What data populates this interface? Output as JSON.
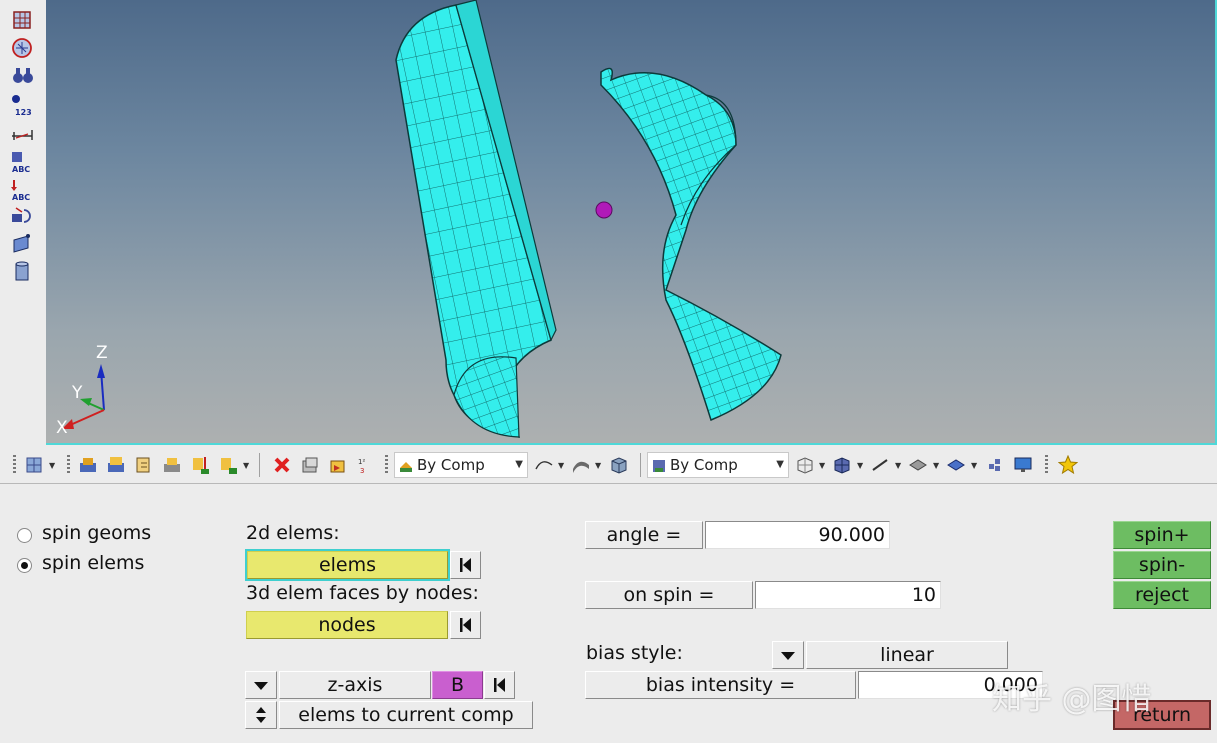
{
  "viewport": {
    "axis_labels": {
      "z": "Z",
      "y": "Y",
      "x": "X"
    },
    "colors": {
      "mesh": "#33f0ee",
      "mesh_edge": "#0c5a5a",
      "temp_node": "#b01ab8"
    }
  },
  "left_toolbar": {
    "icons": [
      "mesh-grid-icon",
      "mesh-circle-icon",
      "binoculars-icon",
      "info-123-icon",
      "measure-icon",
      "label-abc-icon",
      "vector-abc-icon",
      "rotate-icon",
      "surface-icon",
      "cylinder-icon"
    ],
    "text": {
      "info": "123",
      "label": "ABC",
      "vector": "ABC"
    }
  },
  "toolbar": {
    "comp_color_combo_1": "By Comp",
    "comp_color_combo_2": "By Comp"
  },
  "panel": {
    "radio_spin_geoms": {
      "label": "spin geoms",
      "selected": false
    },
    "radio_spin_elems": {
      "label": "spin elems",
      "selected": true
    },
    "label_2d_elems": "2d elems:",
    "elems_button": "elems",
    "label_3d_faces": "3d elem faces by nodes:",
    "nodes_button": "nodes",
    "axis_button": "z-axis",
    "b_button": "B",
    "elems_to_comp_button": "elems to current comp",
    "angle_label": "angle =",
    "angle_value": "90.000",
    "on_spin_label": "on spin =",
    "on_spin_value": "10",
    "bias_style_label": "bias style:",
    "bias_style_value": "linear",
    "bias_intensity_label": "bias intensity =",
    "bias_intensity_value": "0.000",
    "spin_plus_button": "spin+",
    "spin_minus_button": "spin-",
    "reject_button": "reject",
    "return_button": "return"
  },
  "watermark": "知乎 @图惜"
}
